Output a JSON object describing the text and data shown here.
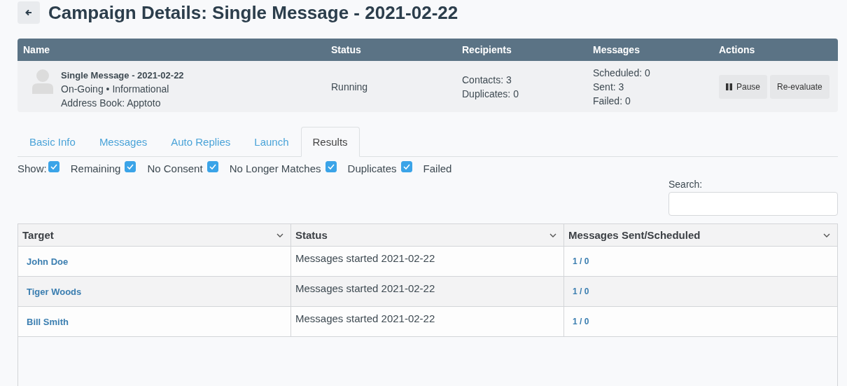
{
  "page_title": "Campaign Details: Single Message - 2021-02-22",
  "summary": {
    "columns": [
      "Name",
      "Status",
      "Recipients",
      "Messages",
      "Actions"
    ],
    "name": "Single Message - 2021-02-22",
    "type_line": "On-Going • Informational",
    "address_book": "Address Book: Apptoto",
    "status": "Running",
    "recipients": [
      "Contacts: 3",
      "Duplicates: 0"
    ],
    "messages": [
      "Scheduled: 0",
      "Sent: 3",
      "Failed: 0"
    ],
    "actions": [
      {
        "label": "Pause",
        "kind": "pause"
      },
      {
        "label": "Re-evaluate",
        "kind": "plain"
      }
    ]
  },
  "tabs": [
    {
      "label": "Basic Info",
      "selected": false
    },
    {
      "label": "Messages",
      "selected": false
    },
    {
      "label": "Auto Replies",
      "selected": false
    },
    {
      "label": "Launch",
      "selected": false
    },
    {
      "label": "Results",
      "selected": true
    }
  ],
  "filters": {
    "label": "Show:",
    "options": [
      {
        "label": "Remaining",
        "checked": true
      },
      {
        "label": "No Consent",
        "checked": true
      },
      {
        "label": "No Longer Matches",
        "checked": true
      },
      {
        "label": "Duplicates",
        "checked": true
      },
      {
        "label": "Failed",
        "checked": true
      }
    ]
  },
  "search": {
    "label": "Search:"
  },
  "table": {
    "columns": [
      "Target",
      "Status",
      "Messages Sent/Scheduled"
    ],
    "rows": [
      {
        "target": "John Doe",
        "status": "Messages started 2021-02-22",
        "sent": "1 / 0"
      },
      {
        "target": "Tiger Woods",
        "status": "Messages started 2021-02-22",
        "sent": "1 / 0"
      },
      {
        "target": "Bill Smith",
        "status": "Messages started 2021-02-22",
        "sent": "1 / 0"
      }
    ]
  }
}
